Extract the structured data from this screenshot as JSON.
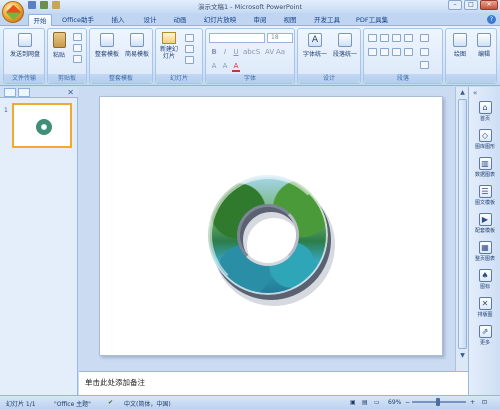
{
  "window": {
    "title": "演示文稿1 - Microsoft PowerPoint"
  },
  "tabs": [
    {
      "label": "开始",
      "active": true
    },
    {
      "label": "Office助手"
    },
    {
      "label": "插入"
    },
    {
      "label": "设计"
    },
    {
      "label": "动画"
    },
    {
      "label": "幻灯片放映"
    },
    {
      "label": "审阅"
    },
    {
      "label": "视图"
    },
    {
      "label": "开发工具"
    },
    {
      "label": "PDF工具集"
    }
  ],
  "ribbon": {
    "groups": [
      {
        "label": "文件传输",
        "buttons": [
          "发送到网盘"
        ]
      },
      {
        "label": "剪贴板",
        "buttons": [
          "粘贴"
        ]
      },
      {
        "label": "整套模板",
        "buttons": [
          "整套模板",
          "简易模板"
        ]
      },
      {
        "label": "幻灯片",
        "buttons": [
          "新建幻灯片"
        ]
      },
      {
        "label": "字体"
      },
      {
        "label": "设计",
        "buttons": [
          "字体统一",
          "段落统一"
        ]
      },
      {
        "label": "段落"
      },
      {
        "label": "",
        "buttons": [
          "绘图",
          "编辑"
        ]
      }
    ],
    "font_size_placeholder": "18"
  },
  "right_panel": {
    "items": [
      "首页",
      "图库图形",
      "数据图表",
      "图文模板",
      "配套模板",
      "整页图表",
      "图标",
      "排版图",
      "更多"
    ]
  },
  "notes": {
    "placeholder": "单击此处添加备注"
  },
  "status": {
    "slide": "幻灯片 1/1",
    "theme": "\"Office 主题\"",
    "language": "中文(简体，中国)",
    "zoom": "69%"
  },
  "slide_thumbnail_number": "1",
  "colors": {
    "accent": "#15428b",
    "selection": "#f3a930"
  }
}
